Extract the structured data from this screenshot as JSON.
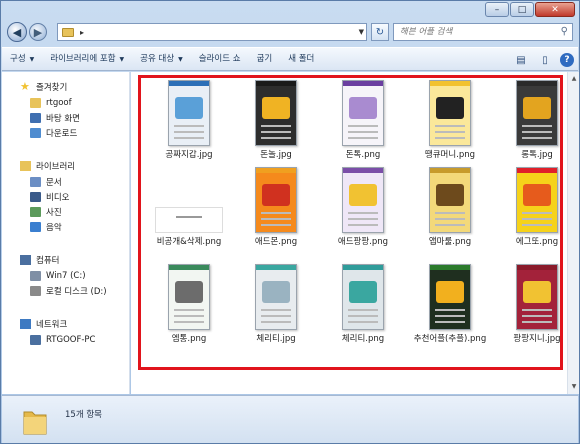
{
  "window": {
    "controls": {
      "minimize": "–",
      "maximize": "□",
      "close": "✕"
    }
  },
  "nav": {
    "back_icon": "back-arrow-icon",
    "forward_icon": "forward-arrow-icon",
    "address_crumb": "▸",
    "search_placeholder": "해븐 어플 검색"
  },
  "toolbar": {
    "items": [
      "구성",
      "라이브러리에 포함",
      "공유 대상",
      "슬라이드 쇼",
      "굽기",
      "새 폴더"
    ],
    "has_caret": [
      true,
      true,
      true,
      false,
      false,
      false
    ]
  },
  "sidebar": {
    "favorites": {
      "label": "즐겨찾기",
      "items": [
        "rtgoof",
        "바탕 화면",
        "다운로드"
      ]
    },
    "libraries": {
      "label": "라이브러리",
      "items": [
        "문서",
        "비디오",
        "사진",
        "음악"
      ]
    },
    "computer": {
      "label": "컴퓨터",
      "items": [
        "Win7 (C:)",
        "로컬 디스크 (D:)"
      ]
    },
    "network": {
      "label": "네트워크",
      "items": [
        "RTGOOF-PC"
      ]
    }
  },
  "files": [
    {
      "name": "공짜지갑.jpg",
      "top": "#2c6fb7",
      "bg": "#e9eff6",
      "accent": "#5aa0d8"
    },
    {
      "name": "돈놀.jpg",
      "top": "#1a1a1a",
      "bg": "#2d2d2d",
      "accent": "#f0b323"
    },
    {
      "name": "돈톡.png",
      "top": "#6b3fa0",
      "bg": "#f6f4f9",
      "accent": "#a98bd0"
    },
    {
      "name": "땡큐머니.png",
      "top": "#f2c230",
      "bg": "#fbe89a",
      "accent": "#222222"
    },
    {
      "name": "롱톡.jpg",
      "top": "#2a2a2a",
      "bg": "#3a3a3a",
      "accent": "#e3a41f"
    },
    {
      "name": "비공개&삭제.png",
      "top": "#ffffff",
      "bg": "#ffffff",
      "accent": "#dddddd"
    },
    {
      "name": "애드몬.png",
      "top": "#f0a020",
      "bg": "#f58a1c",
      "accent": "#d0311f"
    },
    {
      "name": "애드팡팡.png",
      "top": "#7b4ea8",
      "bg": "#efe7f7",
      "accent": "#f1c232"
    },
    {
      "name": "앱마룰.png",
      "top": "#c79b2c",
      "bg": "#f3d97a",
      "accent": "#6d4a1c"
    },
    {
      "name": "에그또.png",
      "top": "#e0202a",
      "bg": "#f6d21a",
      "accent": "#e65b1c"
    },
    {
      "name": "엠통.png",
      "top": "#3a8a5c",
      "bg": "#f2f6f2",
      "accent": "#6c6c6c"
    },
    {
      "name": "체리티.jpg",
      "top": "#3aa7a0",
      "bg": "#e8ecef",
      "accent": "#9ab3c1"
    },
    {
      "name": "체리티.png",
      "top": "#2f9c9a",
      "bg": "#dfe6ea",
      "accent": "#3aa7a0"
    },
    {
      "name": "추천어플(추플).png",
      "top": "#2b7a2b",
      "bg": "#1f2f1f",
      "accent": "#f2b01e"
    },
    {
      "name": "팡팡지니.jpg",
      "top": "#8a1a2a",
      "bg": "#a3223a",
      "accent": "#f1c232"
    }
  ],
  "status": {
    "count_text": "15개 항목"
  }
}
